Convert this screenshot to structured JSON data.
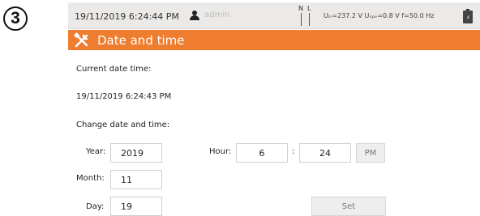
{
  "step_number": "3",
  "status_bar": {
    "datetime": "19/11/2019 6:24:44 PM",
    "user": "admin",
    "phase_n": "N",
    "phase_l": "L",
    "measurements": "Uₗₙ=237.2 V Uₙₚₑ=0.8 V f=50.0 Hz"
  },
  "header": {
    "title": "Date and time",
    "accent_color": "#ee7d30"
  },
  "current": {
    "label": "Current date time:",
    "value": "19/11/2019 6:24:43 PM"
  },
  "change": {
    "label": "Change date and time:",
    "year_label": "Year:",
    "year": "2019",
    "month_label": "Month:",
    "month": "11",
    "day_label": "Day:",
    "day": "19",
    "hour_label": "Hour:",
    "hour": "6",
    "colon": ":",
    "minute": "24",
    "ampm": "PM",
    "set_label": "Set"
  }
}
